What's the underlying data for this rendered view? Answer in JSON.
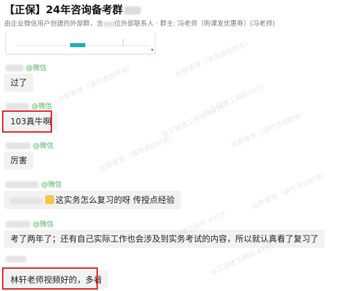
{
  "header": {
    "title": "【正保】24年咨询备考群",
    "subtitle_prefix": "由企业微信用户创建的外部群，含",
    "subtitle_suffix": "位外部联系人 · 群主: 冯老师（购课发优惠券）(冯老师)"
  },
  "messages": [
    {
      "source": "@微信",
      "text": "过了"
    },
    {
      "source": "@微信",
      "text": "103真牛啊"
    },
    {
      "source": "@微信",
      "text": "厉害"
    },
    {
      "source": "@微信",
      "text": "这实务怎么复习的呀 传授点经验"
    },
    {
      "source": "@微信",
      "text": "考了两年了；还有自己实际工作也会涉及到实务考试的内容，所以就认真看了复习了"
    },
    {
      "source": "",
      "text": "林轩老师视频好的，多看"
    }
  ],
  "watermarks": [
    "社群管家（请勿添加好友）",
    "@正保建工网校4473",
    "社群管家（请勿添加好友）",
    "@正保建工网校 4473",
    "社群管家（请勿添加好友）",
    "社群管家（请勿添加好友）",
    "@正保建工网校 4473",
    "社群管家（请勿添加好友）",
    "@正保建工网校 4473"
  ],
  "colors": {
    "highlight": "#e61e1e",
    "wechat_tag": "#4ab35d",
    "bubble": "#f2f2f2"
  }
}
